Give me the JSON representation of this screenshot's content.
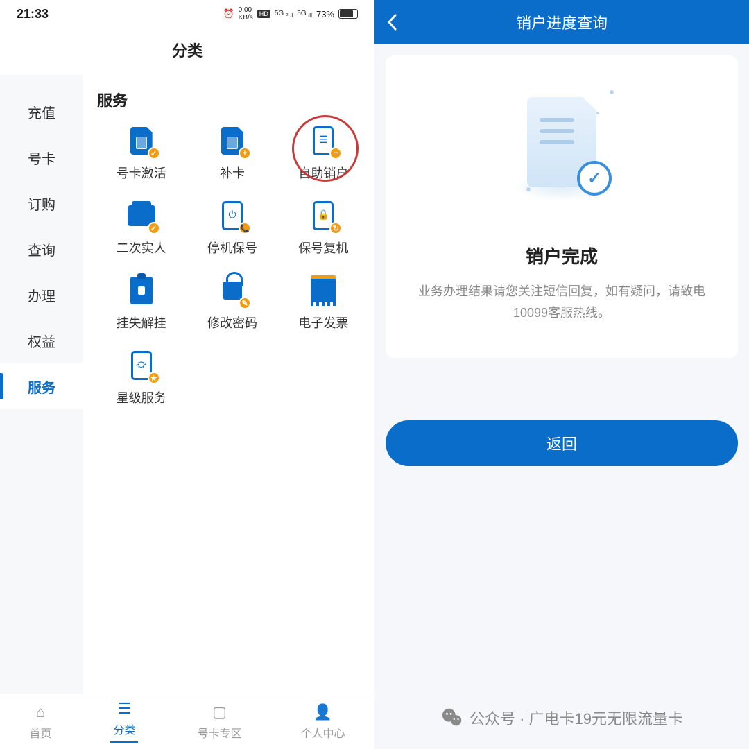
{
  "statusBar": {
    "time": "21:33",
    "speed": "0.00",
    "speedUnit": "KB/s",
    "hd": "HD",
    "net1": "5G",
    "net2": "5G",
    "battery": "73%"
  },
  "left": {
    "title": "分类",
    "sidebar": [
      {
        "label": "充值"
      },
      {
        "label": "号卡"
      },
      {
        "label": "订购"
      },
      {
        "label": "查询"
      },
      {
        "label": "办理"
      },
      {
        "label": "权益"
      },
      {
        "label": "服务",
        "active": true
      }
    ],
    "sectionTitle": "服务",
    "items": [
      {
        "label": "号卡激活",
        "icon": "sim-activate"
      },
      {
        "label": "补卡",
        "icon": "sim-add"
      },
      {
        "label": "自助销户",
        "icon": "self-cancel",
        "circled": true
      },
      {
        "label": "二次实人",
        "icon": "id-card"
      },
      {
        "label": "停机保号",
        "icon": "pause-keep"
      },
      {
        "label": "保号复机",
        "icon": "resume"
      },
      {
        "label": "挂失解挂",
        "icon": "lost-lock"
      },
      {
        "label": "修改密码",
        "icon": "password"
      },
      {
        "label": "电子发票",
        "icon": "receipt"
      },
      {
        "label": "星级服务",
        "icon": "star-service"
      }
    ],
    "bottomNav": [
      {
        "label": "首页",
        "icon": "home"
      },
      {
        "label": "分类",
        "icon": "category",
        "active": true
      },
      {
        "label": "号卡专区",
        "icon": "sim-zone"
      },
      {
        "label": "个人中心",
        "icon": "profile"
      }
    ]
  },
  "right": {
    "headerTitle": "销户进度查询",
    "resultTitle": "销户完成",
    "resultDesc": "业务办理结果请您关注短信回复，如有疑问，请致电10099客服热线。",
    "returnLabel": "返回",
    "watermark": "公众号 · 广电卡19元无限流量卡"
  }
}
